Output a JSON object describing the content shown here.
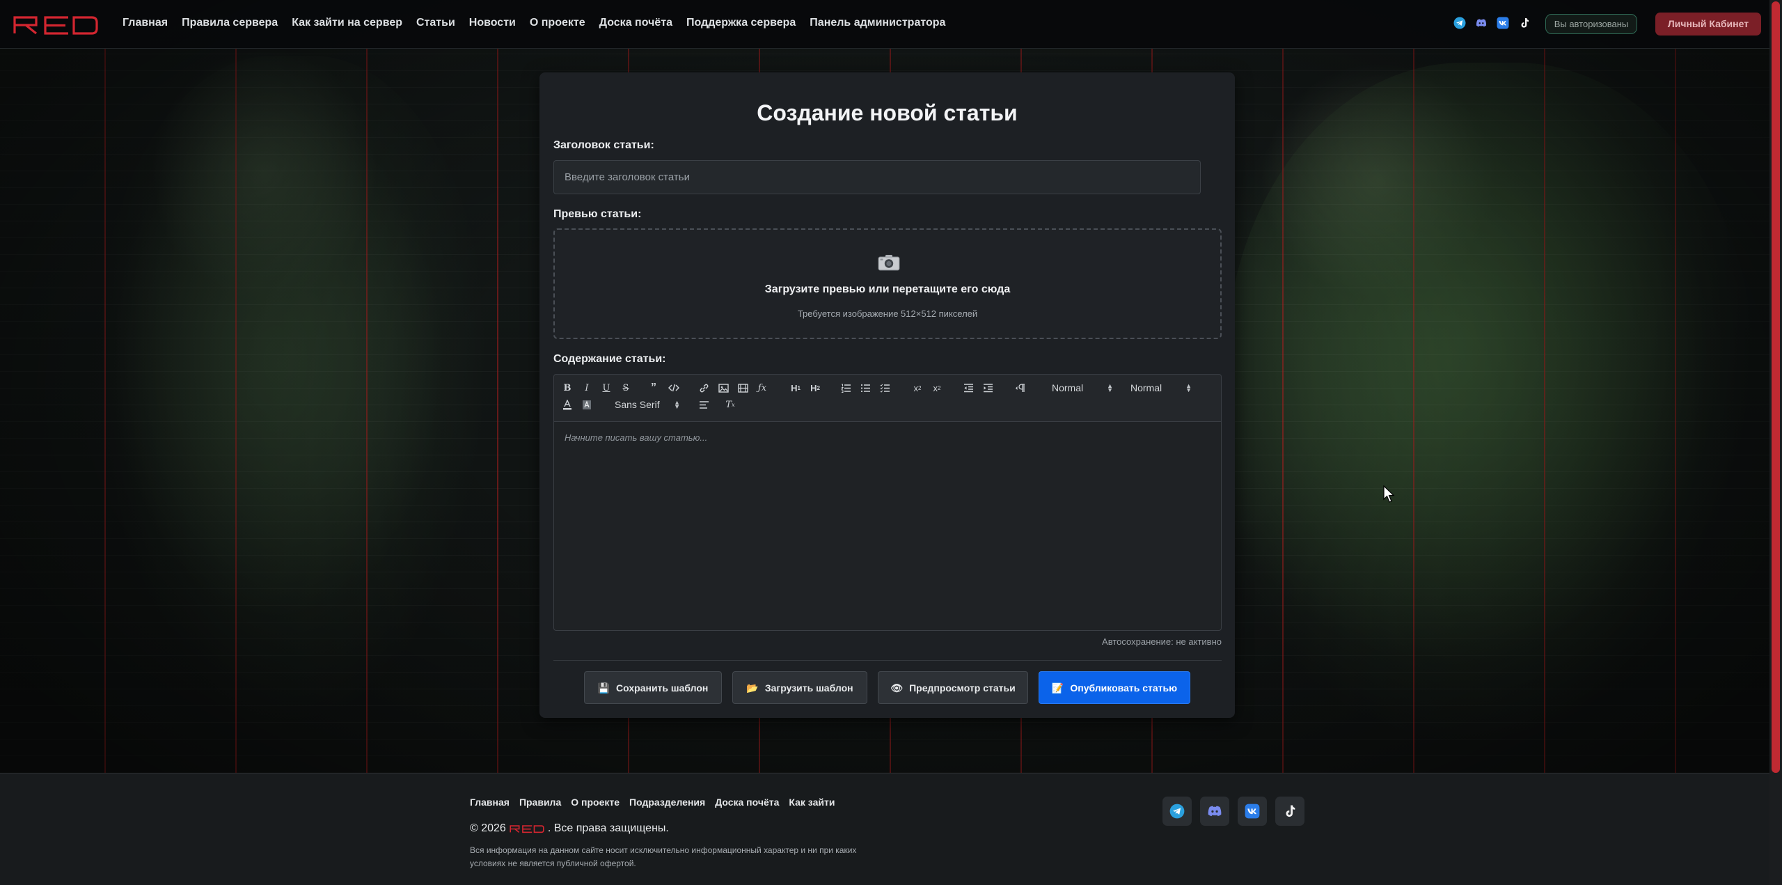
{
  "brand": {
    "logo_text": "RED",
    "color": "#d32630"
  },
  "nav": {
    "links": [
      "Главная",
      "Правила сервера",
      "Как зайти на сервер",
      "Статьи",
      "Новости",
      "О проекте",
      "Доска почёта",
      "Поддержка сервера",
      "Панель администратора"
    ],
    "social_icons": [
      "telegram-icon",
      "discord-icon",
      "vk-icon",
      "tiktok-icon"
    ],
    "auth_status": "Вы авторизованы",
    "cabinet_label": "Личный Кабинет"
  },
  "form": {
    "title": "Создание новой статьи",
    "title_label": "Заголовок статьи:",
    "title_placeholder": "Введите заголовок статьи",
    "title_value": "",
    "preview_label": "Превью статьи:",
    "dropzone_icon": "camera-icon",
    "dropzone_main": "Загрузите превью или перетащите его сюда",
    "dropzone_sub": "Требуется изображение 512×512 пикселей",
    "content_label": "Содержание статьи:",
    "editor": {
      "header_select": "Normal",
      "size_select": "Normal",
      "font_select": "Sans Serif",
      "placeholder": "Начните писать вашу статью...",
      "tool_icons": [
        "bold-icon",
        "italic-icon",
        "underline-icon",
        "strike-icon",
        "blockquote-icon",
        "code-block-icon",
        "link-icon",
        "image-icon",
        "video-icon",
        "formula-icon",
        "header-1-icon",
        "header-2-icon",
        "ordered-list-icon",
        "bullet-list-icon",
        "check-list-icon",
        "subscript-icon",
        "superscript-icon",
        "outdent-icon",
        "indent-icon",
        "direction-rtl-icon",
        "text-color-icon",
        "background-color-icon",
        "align-icon",
        "clean-formatting-icon"
      ]
    },
    "autosave": "Автосохранение: не активно",
    "buttons": {
      "save_template": "Сохранить шаблон",
      "load_template": "Загрузить шаблон",
      "preview": "Предпросмотр статьи",
      "publish": "Опубликовать статью"
    },
    "button_icons": {
      "save_template": "💾",
      "load_template": "📂",
      "preview": "👁",
      "publish": "📝"
    }
  },
  "footer": {
    "links": [
      "Главная",
      "Правила",
      "О проекте",
      "Подразделения",
      "Доска почёта",
      "Как зайти"
    ],
    "copyright_prefix": "© 2026",
    "copyright_suffix": ". Все права защищены.",
    "disclaimer": "Вся информация на данном сайте носит исключительно информационный характер и ни при каких условиях не является публичной офертой.",
    "social_icons": [
      "telegram-icon",
      "discord-icon",
      "vk-icon",
      "tiktok-icon"
    ]
  },
  "colors": {
    "accent_red": "#d32630",
    "primary_blue": "#0b63ea",
    "card_bg": "#1d2024"
  }
}
